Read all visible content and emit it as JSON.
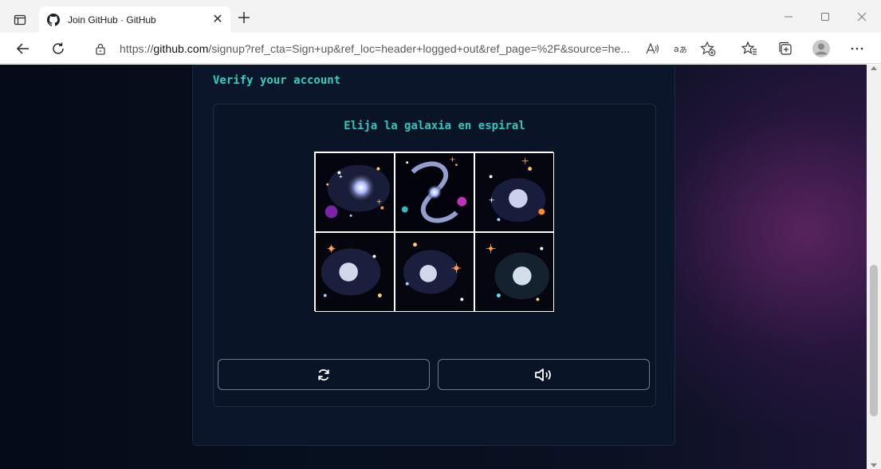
{
  "browser": {
    "tab": {
      "title": "Join GitHub · GitHub",
      "favicon": "github-icon"
    },
    "address_bar": {
      "url_prefix": "https://",
      "url_host": "github.com",
      "url_rest": "/signup?ref_cta=Sign+up&ref_loc=header+logged+out&ref_page=%2F&source=he..."
    },
    "toolbar_icons": [
      "back-icon",
      "refresh-icon",
      "read-aloud-icon",
      "translate-icon",
      "add-favorite-icon",
      "favorites-icon",
      "collections-icon",
      "profile-icon",
      "more-icon"
    ]
  },
  "page": {
    "heading": "Verify your account",
    "challenge": {
      "instruction": "Elija la galaxia en espiral",
      "tiles": [
        {
          "label": "galaxy image 1"
        },
        {
          "label": "galaxy image 2"
        },
        {
          "label": "galaxy image 3"
        },
        {
          "label": "galaxy image 4"
        },
        {
          "label": "galaxy image 5"
        },
        {
          "label": "galaxy image 6"
        }
      ]
    },
    "buttons": {
      "refresh_icon": "reload-icon",
      "audio_icon": "speaker-icon"
    }
  },
  "colors": {
    "accent": "#2fd0c4",
    "card_bg": "#0c162b",
    "page_bg": "#07101f"
  }
}
